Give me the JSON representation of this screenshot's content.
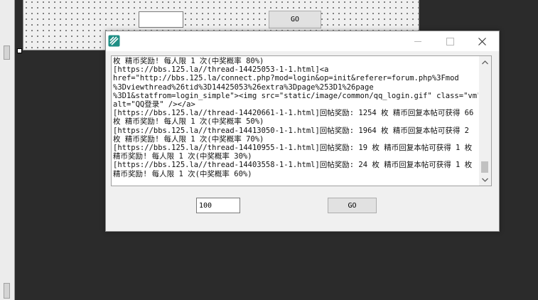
{
  "designer": {
    "go_label": "GO"
  },
  "window": {
    "title": "",
    "output_lines": [
      "枚 精币奖励! 每人限 1 次(中奖概率 80%)",
      "[https://bbs.125.la//thread-14425053-1-1.html]<a",
      "href=\"http://bbs.125.la/connect.php?mod=login&op=init&referer=forum.php%3Fmod",
      "%3Dviewthread%26tid%3D14425053%26extra%3Dpage%253D1%26page",
      "%3D1&statfrom=login_simple\"><img src=\"static/image/common/qq_login.gif\" class=\"vm\"",
      "alt=\"QQ登录\" /></a>",
      "[https://bbs.125.la//thread-14420661-1-1.html]回帖奖励: 1254 枚 精币回复本帖可获得 66",
      "枚 精币奖励! 每人限 1 次(中奖概率 50%)",
      "[https://bbs.125.la//thread-14413050-1-1.html]回帖奖励: 1964 枚 精币回复本帖可获得 2",
      "枚 精币奖励! 每人限 1 次(中奖概率 70%)",
      "[https://bbs.125.la//thread-14410955-1-1.html]回帖奖励: 19 枚 精币回复本帖可获得 1 枚",
      "精币奖励! 每人限 1 次(中奖概率 30%)",
      "[https://bbs.125.la//thread-14403558-1-1.html]回帖奖励: 24 枚 精币回复本帖可获得 1 枚",
      "精币奖励! 每人限 1 次(中奖概率 60%)"
    ],
    "count_value": "100",
    "go_label": "GO"
  },
  "icons": {
    "app": "app-logo-icon",
    "minimize": "minimize-icon",
    "maximize": "maximize-icon",
    "close": "close-icon",
    "scroll_up": "scroll-up-arrow-icon",
    "scroll_down": "scroll-down-arrow-icon"
  },
  "colors": {
    "app_icon": "#1f8f85",
    "desktop": "#2b2b2b",
    "window_bg": "#f0f0f0"
  }
}
